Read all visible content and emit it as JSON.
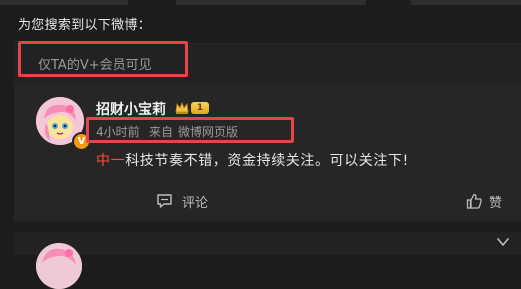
{
  "search": {
    "title": "为您搜索到以下微博："
  },
  "restriction": {
    "label": "仅TA的V+会员可见"
  },
  "post": {
    "username": "招财小宝莉",
    "level_badge": "1",
    "vip_badge": "V",
    "time": "4小时前",
    "source_prefix": "来自",
    "source": "微博网页版",
    "content_highlight": "中一",
    "content_rest": "科技节奏不错，资金持续关注。可以关注下!",
    "actions": {
      "comment_label": "评论",
      "like_label": "赞"
    }
  },
  "colors": {
    "accent_red": "#e64545",
    "highlight_text": "#ff4a3d",
    "background": "#1c1c1c",
    "card": "#262626"
  }
}
